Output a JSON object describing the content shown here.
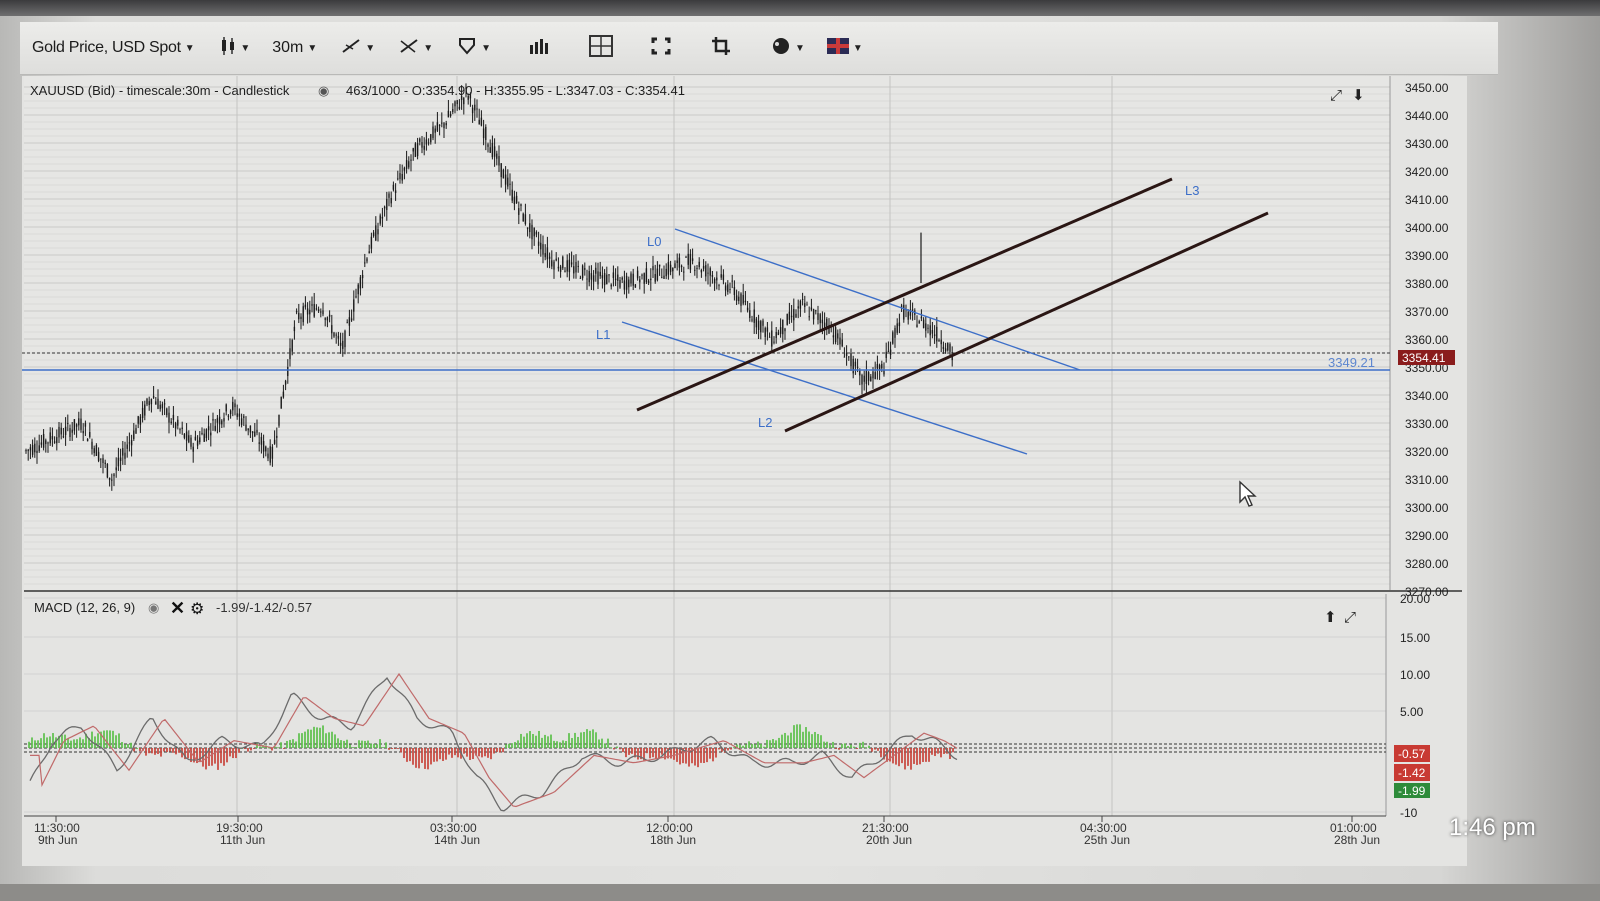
{
  "toolbar": {
    "symbol_label": "Gold Price, USD Spot",
    "timeframe_label": "30m",
    "icons": [
      "candlestick-icon",
      "line-tool-icon",
      "crosshair-tool-icon",
      "shape-tool-icon",
      "bar-chart-icon",
      "layout-grid-icon",
      "expand-icon",
      "crop-icon",
      "palette-icon",
      "flag-grid-icon"
    ]
  },
  "price_panel": {
    "header": "XAUUSD (Bid) - timescale:30m - Candlestick",
    "ohlc": "463/1000 - O:3354.90 - H:3355.95 - L:3347.03 - C:3354.41",
    "y_ticks": [
      "3450.00",
      "3440.00",
      "3430.00",
      "3420.00",
      "3410.00",
      "3400.00",
      "3390.00",
      "3380.00",
      "3370.00",
      "3360.00",
      "3350.00",
      "3340.00",
      "3330.00",
      "3320.00",
      "3310.00",
      "3300.00",
      "3290.00",
      "3280.00",
      "3270.00"
    ],
    "current_price_tag": "3354.41",
    "hline_label": "3349.21",
    "line_labels": [
      "L0",
      "L1",
      "L2",
      "L3"
    ]
  },
  "macd_panel": {
    "header": "MACD (12, 26, 9)",
    "values_text": "-1.99/-1.42/-0.57",
    "y_ticks": [
      "20.00",
      "15.00",
      "10.00",
      "5.00",
      "-10"
    ],
    "tags": [
      {
        "text": "-0.57",
        "color": "#c83a33"
      },
      {
        "text": "-1.42",
        "color": "#c83a33"
      },
      {
        "text": "-1.99",
        "color": "#2e8b3a"
      }
    ]
  },
  "x_axis": [
    {
      "time": "11:30:00",
      "date": "9th Jun"
    },
    {
      "time": "19:30:00",
      "date": "11th Jun"
    },
    {
      "time": "03:30:00",
      "date": "14th Jun"
    },
    {
      "time": "12:00:00",
      "date": "18th Jun"
    },
    {
      "time": "21:30:00",
      "date": "20th Jun"
    },
    {
      "time": "04:30:00",
      "date": "25th Jun"
    },
    {
      "time": "01:00:00",
      "date": "28th Jun"
    }
  ],
  "clock": "1:46 pm",
  "colors": {
    "trend_dark": "#2a1614",
    "trend_blue": "#3d6fc8",
    "hist_green": "#5cc04a",
    "hist_red": "#c8433a",
    "price_tag": "#8a1c1c"
  }
}
